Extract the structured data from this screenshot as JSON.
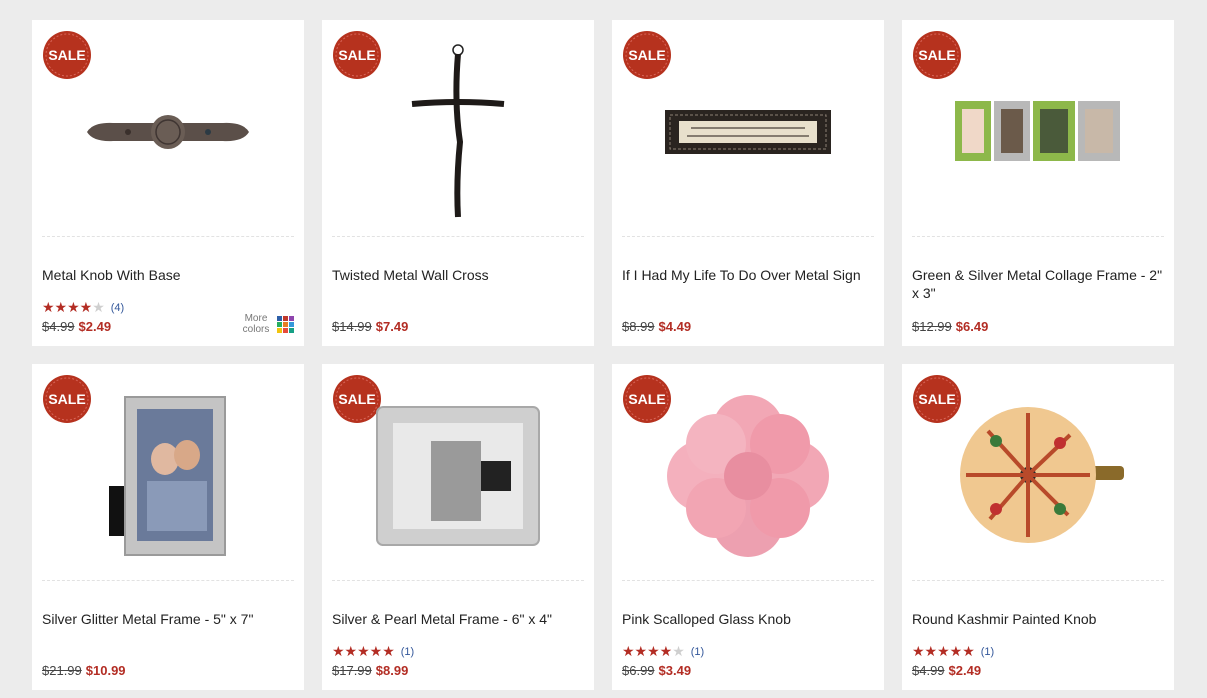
{
  "colors": {
    "accent": "#b32d24",
    "badge": "#b6321e",
    "link": "#33579a"
  },
  "badge_label": "SALE",
  "products": [
    {
      "title": "Metal Knob With Base",
      "old_price": "$4.99",
      "new_price": "$2.49",
      "stars": 4,
      "rating_count": "(4)",
      "more_colors": "More colors",
      "image": "metal-knob-image"
    },
    {
      "title": "Twisted Metal Wall Cross",
      "old_price": "$14.99",
      "new_price": "$7.49",
      "stars": null,
      "rating_count": "",
      "image": "wall-cross-image"
    },
    {
      "title": "If I Had My Life To Do Over Metal Sign",
      "old_price": "$8.99",
      "new_price": "$4.49",
      "stars": null,
      "rating_count": "",
      "image": "metal-sign-image"
    },
    {
      "title": "Green & Silver Metal Collage Frame - 2\" x 3\"",
      "old_price": "$12.99",
      "new_price": "$6.49",
      "stars": null,
      "rating_count": "",
      "image": "collage-frame-image"
    },
    {
      "title": "Silver Glitter Metal Frame - 5\" x 7\"",
      "old_price": "$21.99",
      "new_price": "$10.99",
      "stars": null,
      "rating_count": "",
      "image": "glitter-frame-image"
    },
    {
      "title": "Silver & Pearl Metal Frame - 6\" x 4\"",
      "old_price": "$17.99",
      "new_price": "$8.99",
      "stars": 5,
      "rating_count": "(1)",
      "image": "pearl-frame-image"
    },
    {
      "title": "Pink Scalloped Glass Knob",
      "old_price": "$6.99",
      "new_price": "$3.49",
      "stars": 4,
      "rating_count": "(1)",
      "image": "pink-knob-image"
    },
    {
      "title": "Round Kashmir Painted Knob",
      "old_price": "$4.99",
      "new_price": "$2.49",
      "stars": 5,
      "rating_count": "(1)",
      "image": "kashmir-knob-image"
    }
  ]
}
